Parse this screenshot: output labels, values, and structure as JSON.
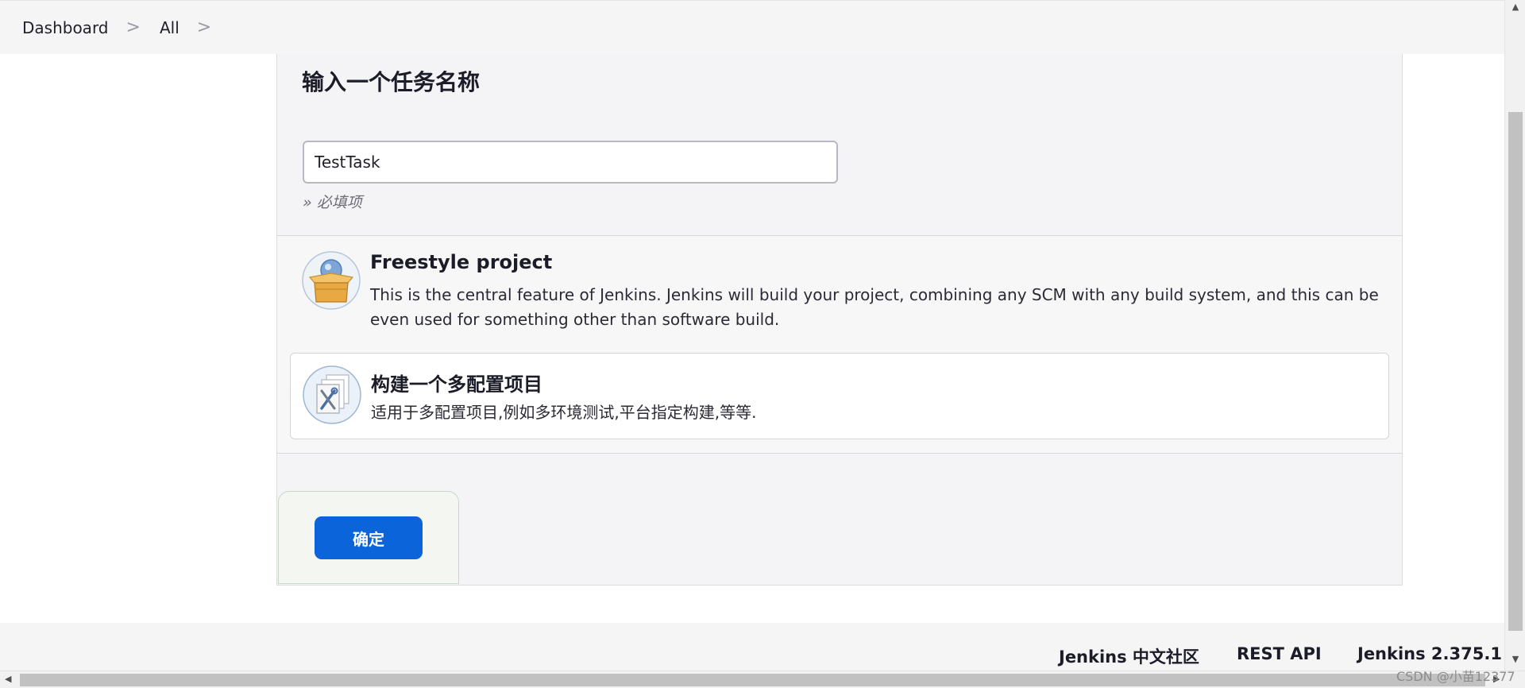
{
  "breadcrumb": {
    "items": [
      "Dashboard",
      "All"
    ],
    "separator": ">"
  },
  "form": {
    "title": "输入一个任务名称",
    "name_value": "TestTask",
    "required_hint": "» 必填项"
  },
  "item_types": [
    {
      "name": "Freestyle project",
      "description": "This is the central feature of Jenkins. Jenkins will build your project, combining any SCM with any build system, and this can be even used for something other than software build.",
      "icon": "freestyle-box-icon"
    },
    {
      "name": "构建一个多配置项目",
      "description": "适用于多配置项目,例如多环境测试,平台指定构建,等等.",
      "icon": "multi-config-tools-icon"
    }
  ],
  "actions": {
    "ok_label": "确定"
  },
  "footer": {
    "links": [
      "Jenkins 中文社区",
      "REST API",
      "Jenkins 2.375.1"
    ]
  },
  "scrollbars": {
    "up_arrow": "▲",
    "down_arrow": "▼",
    "left_arrow": "◀",
    "right_arrow": "▶"
  },
  "watermark": "CSDN @小苗12377",
  "colors": {
    "accent": "#0b64d9",
    "panel_bg": "#f4f4f7"
  }
}
